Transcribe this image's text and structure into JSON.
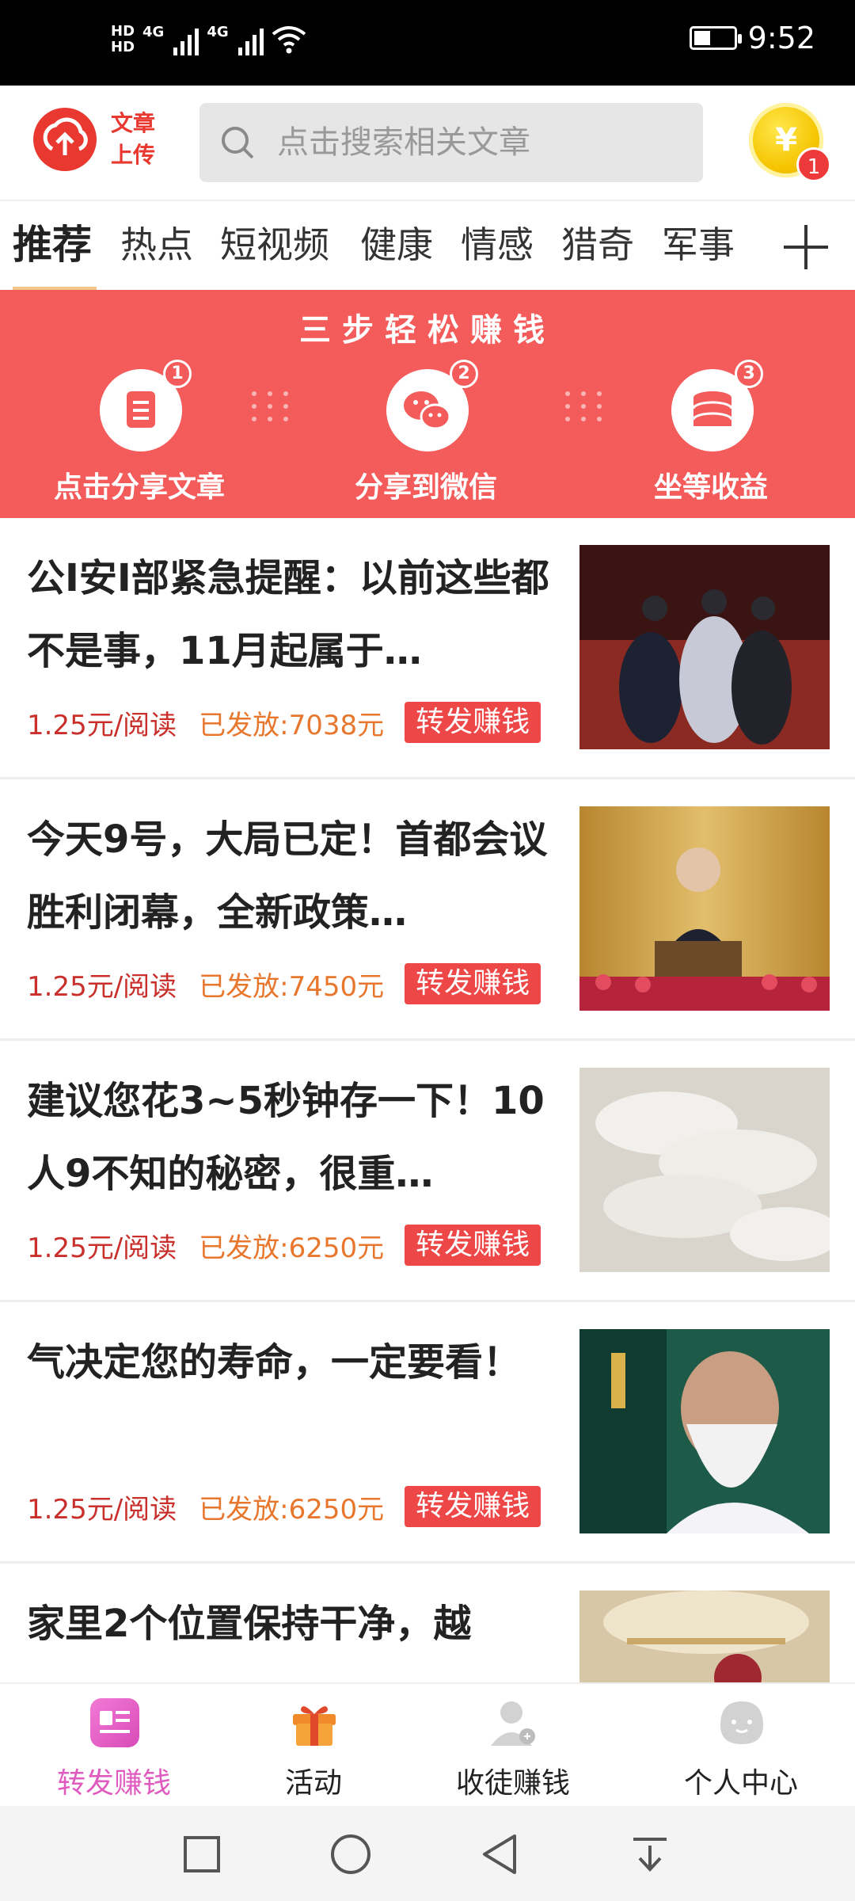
{
  "status_bar": {
    "hd1": "HD",
    "hd2": "HD",
    "net1": "4G",
    "net2": "4G",
    "time": "9:52"
  },
  "header": {
    "logo_text": "文章上传",
    "search_placeholder": "点击搜索相关文章",
    "coin_symbol": "¥",
    "coin_badge": "1"
  },
  "tabs": [
    "推荐",
    "热点",
    "短视频",
    "健康",
    "情感",
    "猎奇",
    "军事"
  ],
  "banner": {
    "title": "三步轻松赚钱",
    "steps": [
      {
        "num": "1",
        "label": "点击分享文章",
        "icon": "document-icon"
      },
      {
        "num": "2",
        "label": "分享到微信",
        "icon": "wechat-icon"
      },
      {
        "num": "3",
        "label": "坐等收益",
        "icon": "coins-icon"
      }
    ]
  },
  "articles": [
    {
      "title": "公I安I部紧急提醒：以前这些都不是事，11月起属于…",
      "price": "1.25元/阅读",
      "paid": "已发放:7038元",
      "button": "转发赚钱"
    },
    {
      "title": "今天9号，大局已定！首都会议胜利闭幕，全新政策…",
      "price": "1.25元/阅读",
      "paid": "已发放:7450元",
      "button": "转发赚钱"
    },
    {
      "title": "建议您花3~5秒钟存一下！10人9不知的秘密，很重…",
      "price": "1.25元/阅读",
      "paid": "已发放:6250元",
      "button": "转发赚钱"
    },
    {
      "title": "气决定您的寿命，一定要看！",
      "price": "1.25元/阅读",
      "paid": "已发放:6250元",
      "button": "转发赚钱"
    },
    {
      "title": "家里2个位置保持干净，越",
      "price": "",
      "paid": "",
      "button": ""
    }
  ],
  "bottom_nav": [
    {
      "label": "转发赚钱",
      "active": true
    },
    {
      "label": "活动",
      "active": false
    },
    {
      "label": "收徒赚钱",
      "active": false
    },
    {
      "label": "个人中心",
      "active": false
    }
  ],
  "colors": {
    "accent": "#f45c5c",
    "price": "#c9302c",
    "paid": "#e8772e",
    "nav_active": "#e05bbf"
  }
}
